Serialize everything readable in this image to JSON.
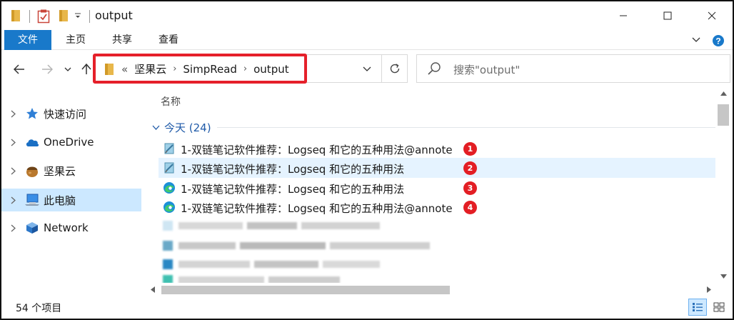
{
  "window": {
    "title": "output",
    "close_label": "✕",
    "minimize_label": "—",
    "maximize_label": "☐"
  },
  "ribbon": {
    "tabs": [
      {
        "label": "文件",
        "active": true
      },
      {
        "label": "主页"
      },
      {
        "label": "共享"
      },
      {
        "label": "查看"
      }
    ]
  },
  "address": {
    "overflow_label": "«",
    "crumbs": [
      "坚果云",
      "SimpRead",
      "output"
    ]
  },
  "search": {
    "placeholder": "搜索\"output\""
  },
  "nav": {
    "items": [
      {
        "label": "快速访问",
        "icon": "star-icon"
      },
      {
        "label": "OneDrive",
        "icon": "cloud-icon"
      },
      {
        "label": "坚果云",
        "icon": "nut-icon"
      },
      {
        "label": "此电脑",
        "icon": "computer-icon",
        "selected": true
      },
      {
        "label": "Network",
        "icon": "network-icon"
      }
    ]
  },
  "content": {
    "column_name": "名称",
    "group_label": "今天 (24)",
    "files": [
      {
        "name": "1-双链笔记软件推荐：Logseq 和它的五种用法@annote",
        "icon": "notepad-icon",
        "badge": "1"
      },
      {
        "name": "1-双链笔记软件推荐：Logseq 和它的五种用法",
        "icon": "notepad-icon",
        "badge": "2",
        "selected": true
      },
      {
        "name": "1-双链笔记软件推荐：Logseq 和它的五种用法",
        "icon": "edge-icon",
        "badge": "3"
      },
      {
        "name": "1-双链笔记软件推荐：Logseq 和它的五种用法@annote",
        "icon": "edge-icon",
        "badge": "4"
      }
    ]
  },
  "status": {
    "item_count": "54 个项目"
  },
  "colors": {
    "accent": "#1979ca",
    "selection": "#cce8ff",
    "highlight_border": "#e5202a",
    "badge": "#e31e24"
  }
}
